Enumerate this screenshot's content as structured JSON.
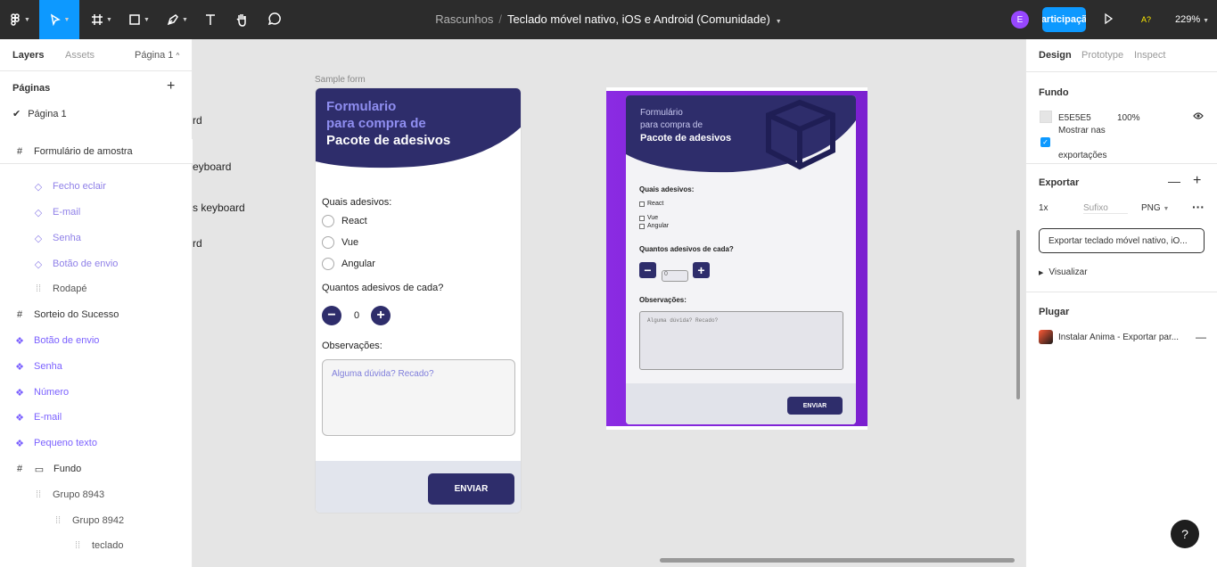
{
  "topbar": {
    "draft": "Rascunhos",
    "separator": "/",
    "file_name": "Teclado móvel nativo, iOS e Android (Comunidade)",
    "avatar_letter": "E",
    "share_label": "articipaçã",
    "a11y_label": "A?",
    "zoom": "229%"
  },
  "left_panel": {
    "tabs": [
      "Layers",
      "Assets"
    ],
    "page_selector": "Página 1",
    "pages_heading": "Páginas",
    "pages": [
      "Página 1"
    ],
    "layers": [
      {
        "label": "Formulário de amostra",
        "icon": "frame-icon"
      },
      {
        "label": "Fecho eclair",
        "icon": "instance-icon"
      },
      {
        "label": "E-mail",
        "icon": "instance-icon"
      },
      {
        "label": "Senha",
        "icon": "instance-icon"
      },
      {
        "label": "Botão de envio",
        "icon": "instance-icon"
      },
      {
        "label": "Rodapé",
        "icon": "group-icon"
      },
      {
        "label": "Sorteio do Sucesso",
        "icon": "frame-icon"
      },
      {
        "label": "Botão de envio",
        "icon": "component-icon"
      },
      {
        "label": "Senha",
        "icon": "component-icon"
      },
      {
        "label": "Número",
        "icon": "component-icon"
      },
      {
        "label": "E-mail",
        "icon": "component-icon"
      },
      {
        "label": "Pequeno texto",
        "icon": "component-icon"
      },
      {
        "label": "Fundo",
        "icon": "frame-icon"
      },
      {
        "label": "Grupo 8943",
        "icon": "group-icon"
      },
      {
        "label": "Grupo 8942",
        "icon": "group-icon"
      },
      {
        "label": "teclado",
        "icon": "group-icon"
      }
    ]
  },
  "canvas": {
    "bg_fragments": [
      "rd",
      "eyboard",
      "s keyboard",
      "rd"
    ],
    "frame_label": "Sample form",
    "form": {
      "title_l1": "Formulario",
      "title_l2": "para compra de",
      "title_l3": "Pacote de adesivos",
      "question1": "Quais adesivos:",
      "options": [
        "React",
        "Vue",
        "Angular"
      ],
      "question2": "Quantos adesivos de cada?",
      "minus": "−",
      "plus": "+",
      "quantity": "0",
      "question3": "Observações:",
      "textarea_placeholder": "Alguma dúvida? Recado?",
      "submit": "ENVIAR"
    },
    "preview": {
      "title_l1": "Formulário",
      "title_l2": "para compra de",
      "title_l3": "Pacote de adesivos",
      "question1": "Quais adesivos:",
      "options": [
        "React",
        "Vue",
        "Angular"
      ],
      "question2": "Quantos adesivos de cada?",
      "minus": "−",
      "plus": "+",
      "quantity": "0",
      "question3": "Observações:",
      "textarea_placeholder": "Alguma dúvida? Recado?",
      "submit": "ENVIAR"
    }
  },
  "right_panel": {
    "tabs": [
      "Design",
      "Prototype",
      "Inspect"
    ],
    "background_title": "Fundo",
    "bg_hex": "E5E5E5",
    "bg_opacity": "100%",
    "show_in_exports_l1": "Mostrar nas",
    "show_in_exports_l2": "exportações",
    "export_title": "Exportar",
    "export_scale": "1x",
    "export_suffix_placeholder": "Sufixo",
    "export_format": "PNG",
    "export_button": "Exportar teclado móvel nativo, iO...",
    "preview_label": "Visualizar",
    "plugin_title": "Plugar",
    "plugin_item": "Instalar Anima - Exportar par...",
    "help": "?"
  },
  "colors": {
    "accent": "#0d99ff",
    "form_navy": "#2e2d6b",
    "component_purple": "#7b61ff",
    "preview_purple": "#8a2be2"
  }
}
